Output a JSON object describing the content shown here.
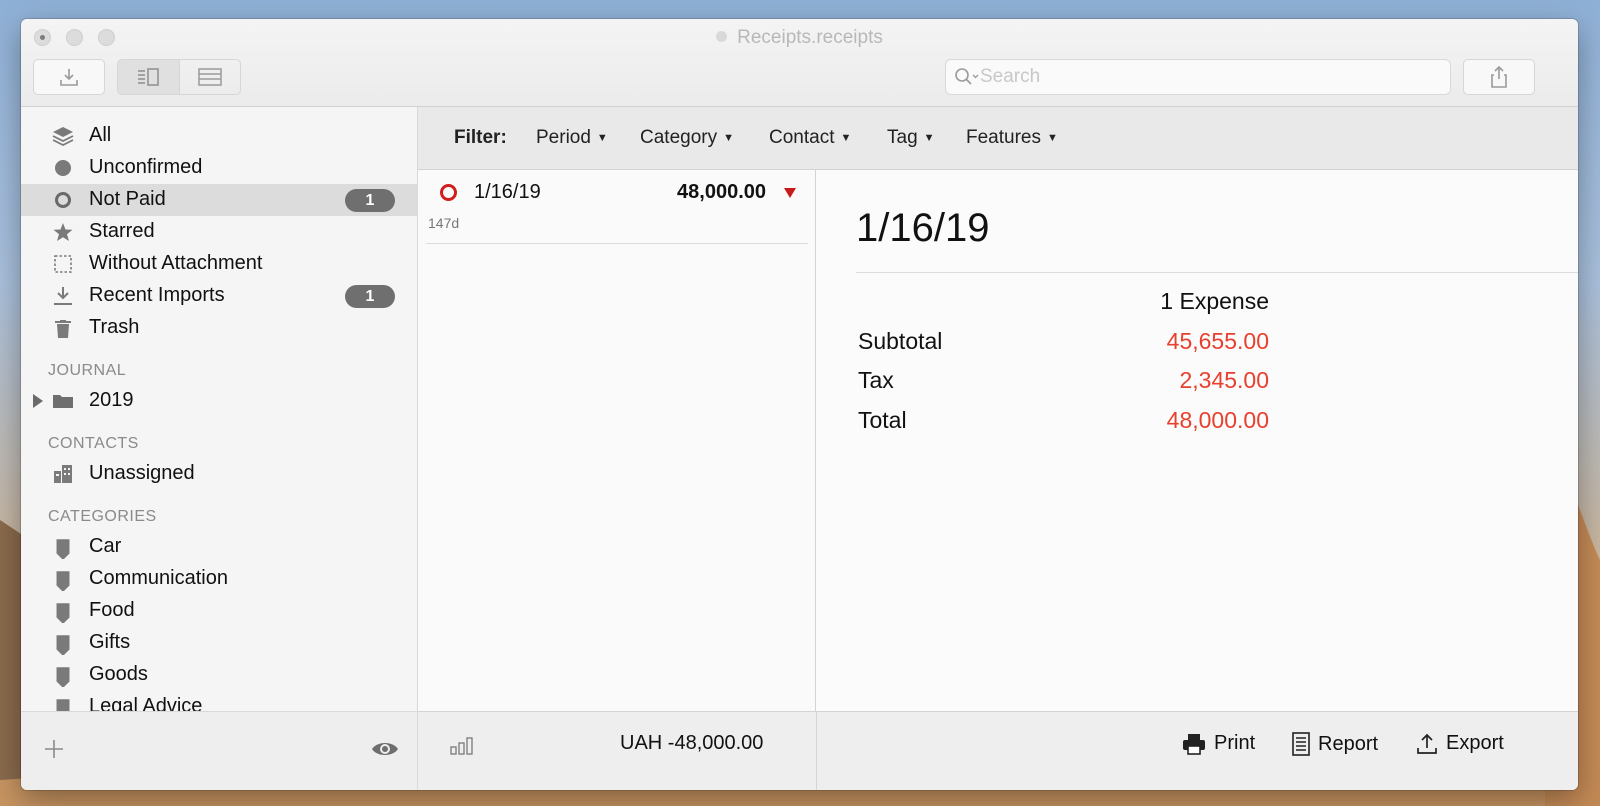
{
  "window": {
    "title": "Receipts.receipts"
  },
  "toolbar": {
    "import_icon": "tray-download-icon",
    "view_split_icon": "split-view-icon",
    "view_list_icon": "list-view-icon",
    "share_icon": "share-icon",
    "search": {
      "placeholder": "Search",
      "value": ""
    }
  },
  "sidebar": {
    "library": [
      {
        "label": "All",
        "icon": "layers-icon",
        "badge": ""
      },
      {
        "label": "Unconfirmed",
        "icon": "filled-circle-icon",
        "badge": ""
      },
      {
        "label": "Not Paid",
        "icon": "ring-icon",
        "badge": "1"
      },
      {
        "label": "Starred",
        "icon": "star-icon",
        "badge": ""
      },
      {
        "label": "Without Attachment",
        "icon": "dashed-square-icon",
        "badge": ""
      },
      {
        "label": "Recent Imports",
        "icon": "download-icon",
        "badge": "1"
      },
      {
        "label": "Trash",
        "icon": "trash-icon",
        "badge": ""
      }
    ],
    "journal_heading": "JOURNAL",
    "journal": [
      {
        "label": "2019",
        "icon": "folder-icon"
      }
    ],
    "contacts_heading": "CONTACTS",
    "contacts": [
      {
        "label": "Unassigned",
        "icon": "building-icon"
      }
    ],
    "categories_heading": "CATEGORIES",
    "categories": [
      {
        "label": "Car",
        "icon": "tag-icon"
      },
      {
        "label": "Communication",
        "icon": "tag-icon"
      },
      {
        "label": "Food",
        "icon": "tag-icon"
      },
      {
        "label": "Gifts",
        "icon": "tag-icon"
      },
      {
        "label": "Goods",
        "icon": "tag-icon"
      },
      {
        "label": "Legal Advice",
        "icon": "tag-icon"
      }
    ]
  },
  "filter": {
    "label": "Filter:",
    "items": [
      "Period",
      "Category",
      "Contact",
      "Tag",
      "Features"
    ]
  },
  "list": {
    "rows": [
      {
        "date": "1/16/19",
        "amount": "48,000.00",
        "age": "147d"
      }
    ]
  },
  "detail": {
    "title": "1/16/19",
    "column_header": "1 Expense",
    "lines": [
      {
        "label": "Subtotal",
        "value": "45,655.00"
      },
      {
        "label": "Tax",
        "value": "2,345.00"
      },
      {
        "label": "Total",
        "value": "48,000.00"
      }
    ]
  },
  "bottom": {
    "total": "UAH -48,000.00",
    "print": "Print",
    "report": "Report",
    "export": "Export"
  },
  "colors": {
    "accent_red": "#e8402e",
    "status_red": "#d21d1d",
    "badge_gray": "#6f6f6f",
    "selection_gray": "#dcdcdc"
  }
}
